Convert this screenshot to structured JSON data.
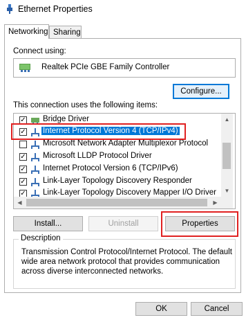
{
  "window": {
    "title": "Ethernet Properties"
  },
  "tabs": [
    {
      "label": "Networking",
      "selected": true
    },
    {
      "label": "Sharing",
      "selected": false
    }
  ],
  "connect_using": {
    "label": "Connect using:",
    "adapter": "Realtek PCIe GBE Family Controller",
    "configure_button": "Configure..."
  },
  "items": {
    "label": "This connection uses the following items:",
    "rows": [
      {
        "text": "Bridge Driver",
        "checked": true,
        "icon": "network-component-icon",
        "selected": false
      },
      {
        "text": "Internet Protocol Version 4 (TCP/IPv4)",
        "checked": true,
        "icon": "network-protocol-icon",
        "selected": true
      },
      {
        "text": "Microsoft Network Adapter Multiplexor Protocol",
        "checked": false,
        "icon": "network-protocol-icon",
        "selected": false
      },
      {
        "text": "Microsoft LLDP Protocol Driver",
        "checked": true,
        "icon": "network-protocol-icon",
        "selected": false
      },
      {
        "text": "Internet Protocol Version 6 (TCP/IPv6)",
        "checked": true,
        "icon": "network-protocol-icon",
        "selected": false
      },
      {
        "text": "Link-Layer Topology Discovery Responder",
        "checked": true,
        "icon": "network-protocol-icon",
        "selected": false
      },
      {
        "text": "Link-Layer Topology Discovery Mapper I/O Driver",
        "checked": true,
        "icon": "network-protocol-icon",
        "selected": false
      }
    ]
  },
  "actions": {
    "install": "Install...",
    "uninstall": "Uninstall",
    "properties": "Properties"
  },
  "description": {
    "label": "Description",
    "text": "Transmission Control Protocol/Internet Protocol. The default wide area network protocol that provides communication across diverse interconnected networks."
  },
  "footer": {
    "ok": "OK",
    "cancel": "Cancel"
  },
  "colors": {
    "selection": "#0078d7",
    "highlight": "#e02020",
    "accent_border": "#0078d7"
  }
}
